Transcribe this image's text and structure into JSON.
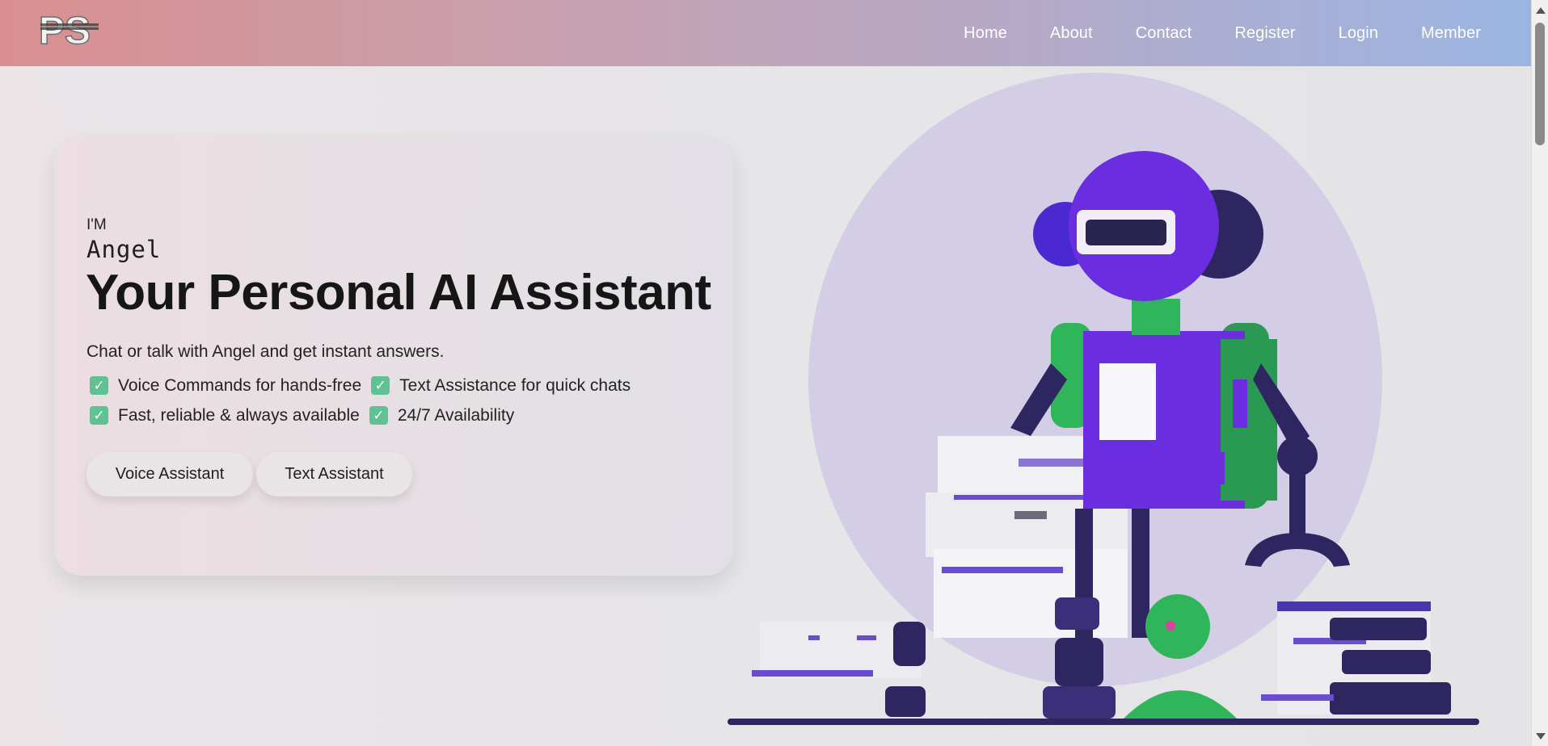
{
  "nav": {
    "logo_text": "PS",
    "links": [
      "Home",
      "About",
      "Contact",
      "Register",
      "Login",
      "Member"
    ]
  },
  "hero": {
    "intro": "I'M",
    "name": "Angel",
    "headline": "Your Personal AI Assistant",
    "subtitle": "Chat or talk with Angel and get instant answers.",
    "features": [
      "Voice Commands for hands-free",
      "Text Assistance for quick chats",
      "Fast, reliable & always available",
      "24/7 Availability"
    ],
    "buttons": {
      "voice": "Voice Assistant",
      "text": "Text Assistant"
    }
  },
  "colors": {
    "nav_gradient_start": "#d98f8f",
    "nav_gradient_end": "#9bb5e3",
    "robot_purple": "#6a2ee0",
    "robot_green": "#2fb55a",
    "robot_dark": "#2e2660",
    "halo": "#d3cde6",
    "check_green": "#5dc394"
  },
  "icons": {
    "logo": "ps-logo-icon",
    "check": "check-box-icon",
    "illustration": "robot-illustration"
  }
}
